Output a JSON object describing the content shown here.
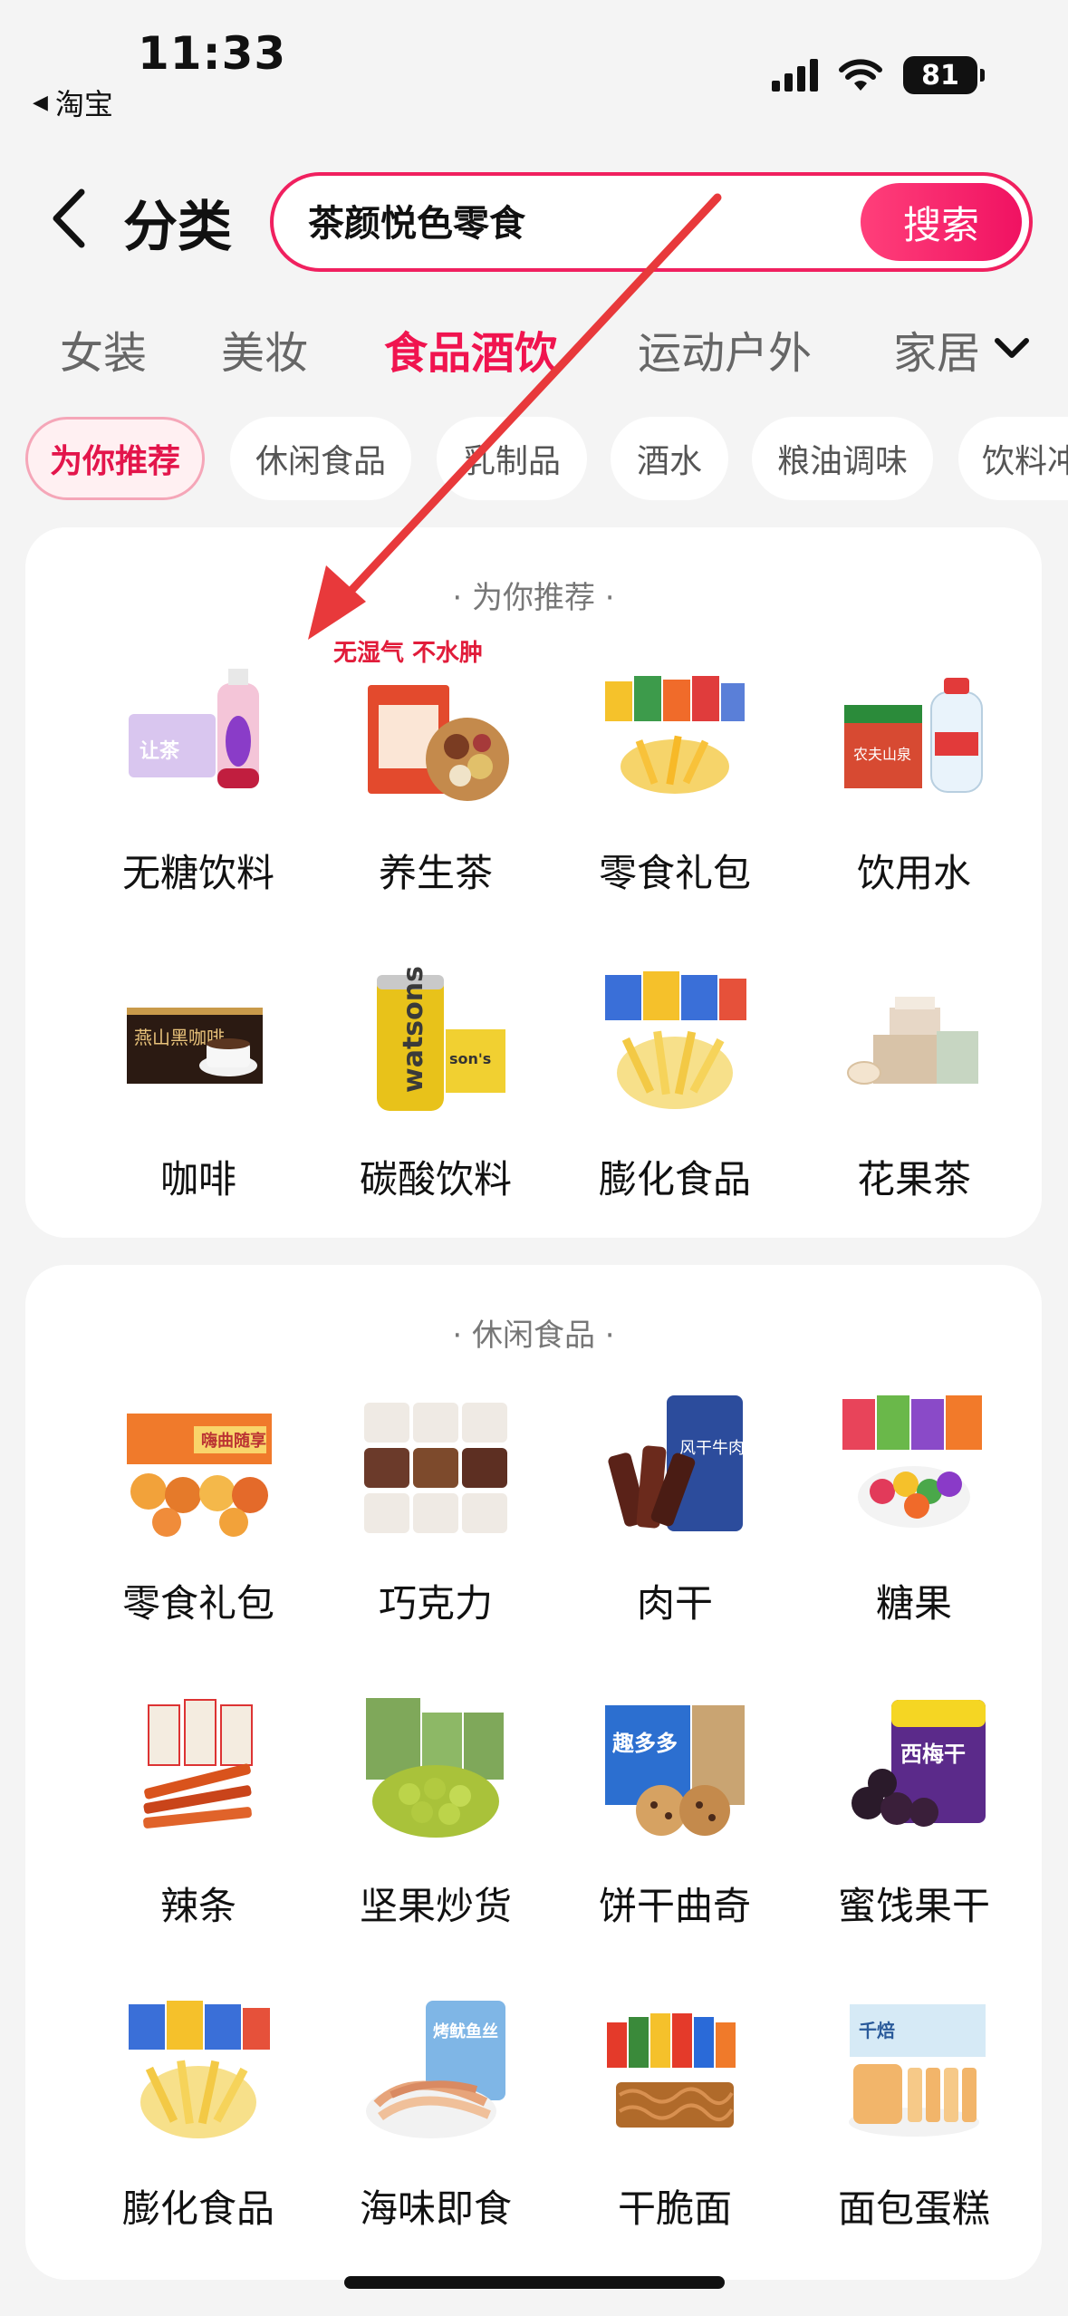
{
  "status_bar": {
    "time": "11:33",
    "back_app": "淘宝",
    "battery": "81",
    "icons": [
      "signal-icon",
      "wifi-icon",
      "battery-icon"
    ]
  },
  "header": {
    "title": "分类",
    "search_value": "茶颜悦色零食",
    "search_button": "搜索",
    "accent_color": "#f0205f"
  },
  "category_tabs": [
    "女装",
    "美妆",
    "食品酒饮",
    "运动户外",
    "家居"
  ],
  "active_category": "食品酒饮",
  "sub_tabs": [
    "为你推荐",
    "休闲食品",
    "乳制品",
    "酒水",
    "粮油调味",
    "饮料冲调"
  ],
  "sections": [
    {
      "title": "· 为你推荐 ·",
      "items": [
        {
          "label": "无糖饮料",
          "icon": "drink-bottle-icon"
        },
        {
          "label": "养生茶",
          "icon": "herbal-tea-icon",
          "badge": "无湿气  不水肿"
        },
        {
          "label": "零食礼包",
          "icon": "snack-pack-icon"
        },
        {
          "label": "饮用水",
          "icon": "water-bottle-icon"
        },
        {
          "label": "咖啡",
          "icon": "coffee-icon"
        },
        {
          "label": "碳酸饮料",
          "icon": "soda-can-icon"
        },
        {
          "label": "膨化食品",
          "icon": "puffed-snack-icon"
        },
        {
          "label": "花果茶",
          "icon": "flower-tea-icon"
        }
      ]
    },
    {
      "title": "· 休闲食品 ·",
      "items": [
        {
          "label": "零食礼包",
          "icon": "snack-pack-icon"
        },
        {
          "label": "巧克力",
          "icon": "chocolate-icon"
        },
        {
          "label": "肉干",
          "icon": "jerky-icon"
        },
        {
          "label": "糖果",
          "icon": "candy-icon"
        },
        {
          "label": "辣条",
          "icon": "spicy-strip-icon"
        },
        {
          "label": "坚果炒货",
          "icon": "nut-icon"
        },
        {
          "label": "饼干曲奇",
          "icon": "cookie-icon"
        },
        {
          "label": "蜜饯果干",
          "icon": "dried-fruit-icon"
        },
        {
          "label": "膨化食品",
          "icon": "puffed-snack-icon"
        },
        {
          "label": "海味即食",
          "icon": "seafood-snack-icon"
        },
        {
          "label": "干脆面",
          "icon": "noodle-snack-icon"
        },
        {
          "label": "面包蛋糕",
          "icon": "bread-icon"
        }
      ]
    }
  ]
}
